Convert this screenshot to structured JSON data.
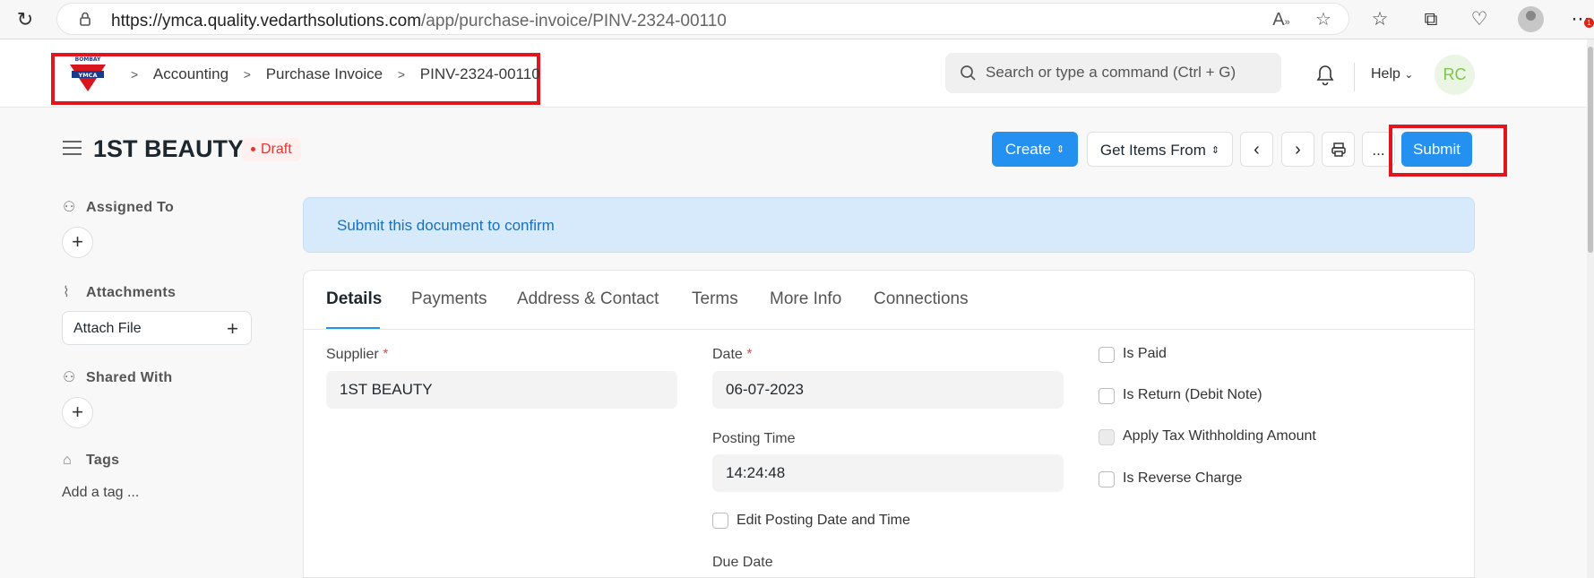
{
  "browser": {
    "url_host": "https://ymca.quality.vedarthsolutions.com",
    "url_path": "/app/purchase-invoice/PINV-2324-00110",
    "notification_count": "1",
    "icons": [
      "reload-icon",
      "lock-icon",
      "read-aloud-icon",
      "favorite-star-icon",
      "favorites-icon",
      "collections-icon",
      "browser-essentials-icon",
      "profile-icon",
      "more-icon"
    ]
  },
  "navbar": {
    "logo_text": "BOMBAY YMCA",
    "breadcrumbs": [
      "Accounting",
      "Purchase Invoice",
      "PINV-2324-00110"
    ],
    "search_placeholder": "Search or type a command (Ctrl + G)",
    "help_label": "Help",
    "avatar_initials": "RC"
  },
  "page": {
    "title": "1ST BEAUTY",
    "status": "Draft",
    "actions": {
      "create": "Create",
      "get_items_from": "Get Items From",
      "more": "...",
      "submit": "Submit"
    }
  },
  "sidebar": {
    "assigned_to": "Assigned To",
    "attachments": "Attachments",
    "attach_file": "Attach File",
    "shared_with": "Shared With",
    "tags": "Tags",
    "add_tag": "Add a tag ..."
  },
  "alert": {
    "message": "Submit this document to confirm"
  },
  "tabs": [
    "Details",
    "Payments",
    "Address & Contact",
    "Terms",
    "More Info",
    "Connections"
  ],
  "form": {
    "supplier_label": "Supplier",
    "supplier_value": "1ST BEAUTY",
    "date_label": "Date",
    "date_value": "06-07-2023",
    "posting_time_label": "Posting Time",
    "posting_time_value": "14:24:48",
    "edit_posting_label": "Edit Posting Date and Time",
    "due_date_label": "Due Date",
    "checkboxes": [
      "Is Paid",
      "Is Return (Debit Note)",
      "Apply Tax Withholding Amount",
      "Is Reverse Charge"
    ]
  },
  "colors": {
    "primary": "#2490ef",
    "highlight": "#e0151d",
    "draft": "#e03636",
    "alert_bg": "#d6eafc"
  }
}
